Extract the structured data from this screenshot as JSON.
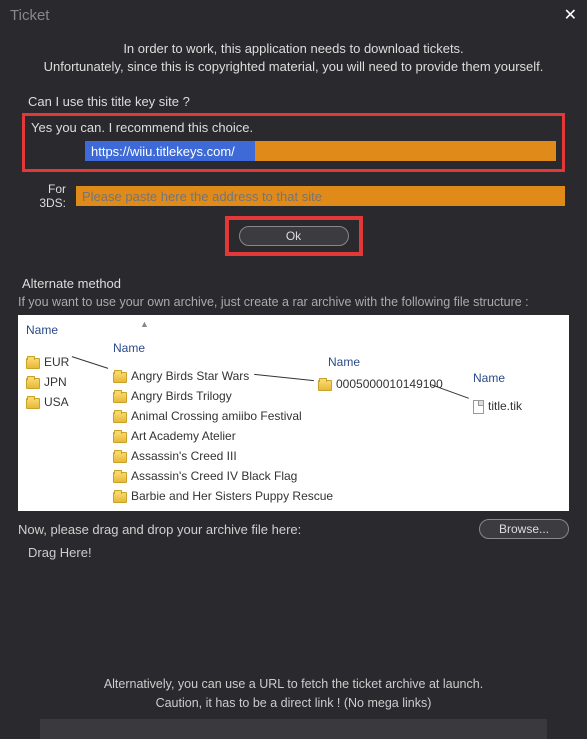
{
  "titlebar": {
    "title": "Ticket"
  },
  "intro": {
    "line1": "In order to work, this application needs to download tickets.",
    "line2": "Unfortunately, since this is copyrighted material, you will need to provide them yourself."
  },
  "titlekey": {
    "question": "Can I use this title key site ?",
    "recommend": "Yes you can. I recommend this choice.",
    "wiiu_label": "",
    "wiiu_url": "https://wiiu.titlekeys.com/",
    "for3ds_label": "For 3DS:",
    "for3ds_placeholder": "Please paste here the address to that site",
    "ok_label": "Ok"
  },
  "alternate": {
    "heading": "Alternate method",
    "desc": "If you want to use your own archive, just create a rar archive with the following file structure :",
    "col_name": "Name",
    "regions": [
      "EUR",
      "JPN",
      "USA"
    ],
    "games": [
      "Angry Birds Star Wars",
      "Angry Birds Trilogy",
      "Animal Crossing amiibo Festival",
      "Art Academy Atelier",
      "Assassin's Creed III",
      "Assassin's Creed IV Black Flag",
      "Barbie and Her Sisters Puppy Rescue"
    ],
    "title_id": "0005000010149100",
    "ticket_file": "title.tik",
    "drag_prompt": "Now, please drag and drop your archive file here:",
    "browse_label": "Browse...",
    "drag_here": "Drag Here!"
  },
  "bottom": {
    "line1": "Alternatively, you can use a URL to fetch the ticket archive at launch.",
    "line2": "Caution, it has to be a direct link ! (No mega links)"
  }
}
